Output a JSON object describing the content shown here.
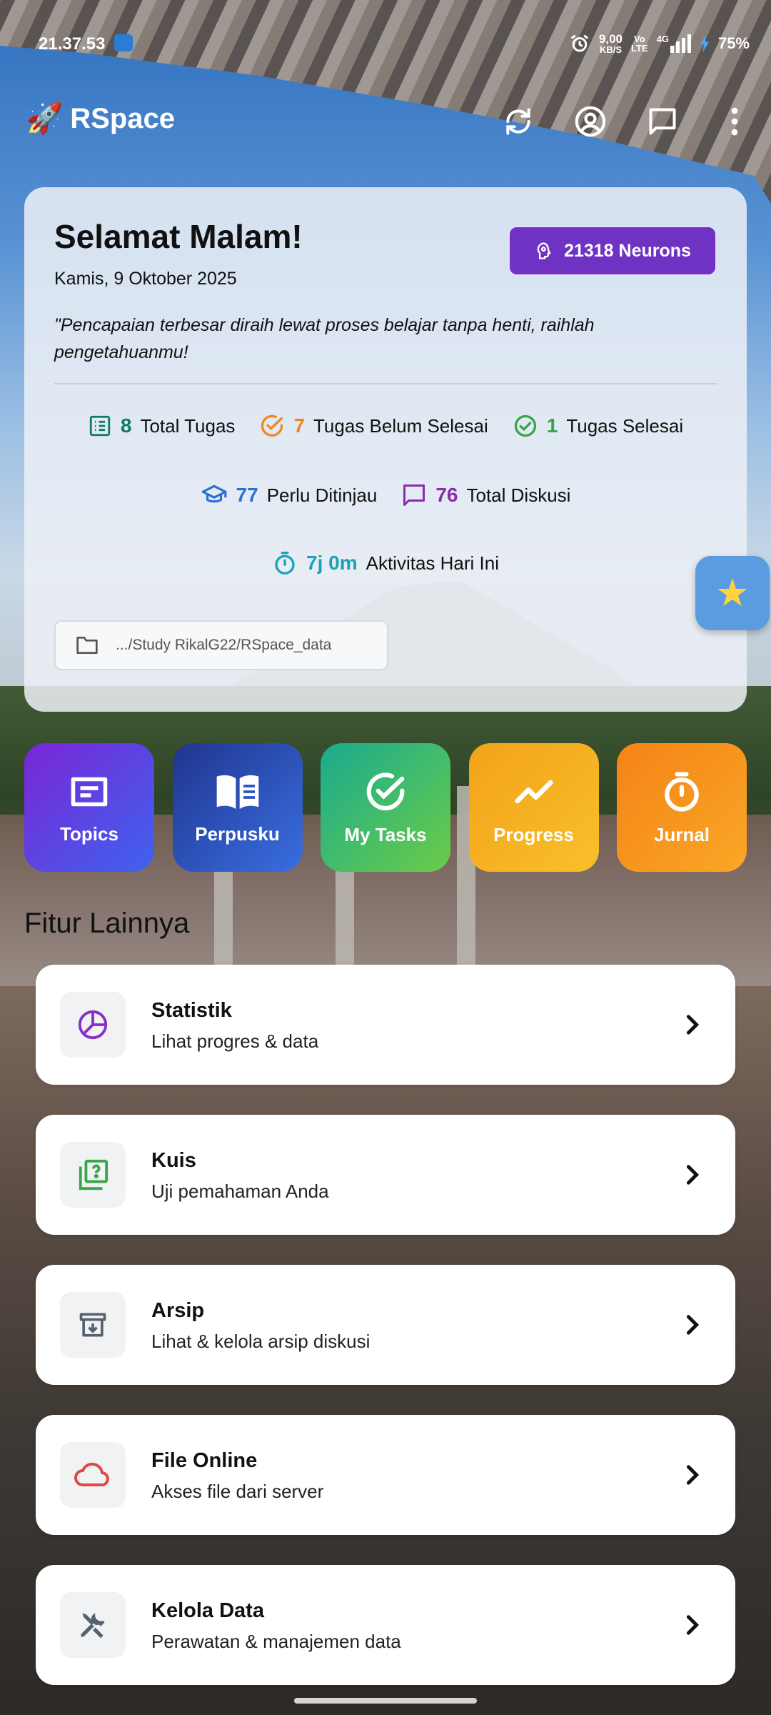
{
  "status_bar": {
    "time": "21.37.53",
    "speed": "9,00",
    "speed_unit": "KB/S",
    "volte_top": "Vo",
    "volte_bottom": "LTE",
    "network": "4G",
    "battery": "75%"
  },
  "app_bar": {
    "title": "RSpace"
  },
  "greeting": {
    "title": "Selamat Malam!",
    "date": "Kamis, 9 Oktober 2025",
    "neurons": "21318 Neurons",
    "quote": "\"Pencapaian terbesar diraih lewat proses belajar tanpa henti, raihlah pengetahuanmu!",
    "stats": {
      "total_tasks": {
        "value": "8",
        "label": "Total Tugas",
        "color": "#117a65"
      },
      "unfinished_tasks": {
        "value": "7",
        "label": "Tugas Belum Selesai",
        "color": "#f0891c"
      },
      "finished_tasks": {
        "value": "1",
        "label": "Tugas Selesai",
        "color": "#3aa548"
      },
      "needs_review": {
        "value": "77",
        "label": "Perlu Ditinjau",
        "color": "#2b72cf"
      },
      "total_discussions": {
        "value": "76",
        "label": "Total Diskusi",
        "color": "#8a2ea8"
      },
      "activity_today": {
        "value": "7j 0m",
        "label": "Aktivitas Hari Ini",
        "color": "#17a2b8"
      }
    },
    "folder_path": ".../Study RikalG22/RSpace_data"
  },
  "tiles": [
    {
      "label": "Topics"
    },
    {
      "label": "Perpusku"
    },
    {
      "label": "My Tasks"
    },
    {
      "label": "Progress"
    },
    {
      "label": "Jurnal"
    }
  ],
  "section_title": "Fitur Lainnya",
  "features": [
    {
      "title": "Statistik",
      "subtitle": "Lihat progres & data",
      "icon": "pie-chart-icon",
      "icon_color": "#8a2ec8"
    },
    {
      "title": "Kuis",
      "subtitle": "Uji pemahaman Anda",
      "icon": "quiz-icon",
      "icon_color": "#3aa548"
    },
    {
      "title": "Arsip",
      "subtitle": "Lihat & kelola arsip diskusi",
      "icon": "archive-icon",
      "icon_color": "#55616e"
    },
    {
      "title": "File Online",
      "subtitle": "Akses file dari server",
      "icon": "cloud-icon",
      "icon_color": "#e04848"
    },
    {
      "title": "Kelola Data",
      "subtitle": "Perawatan & manajemen data",
      "icon": "tools-icon",
      "icon_color": "#55616e"
    }
  ]
}
